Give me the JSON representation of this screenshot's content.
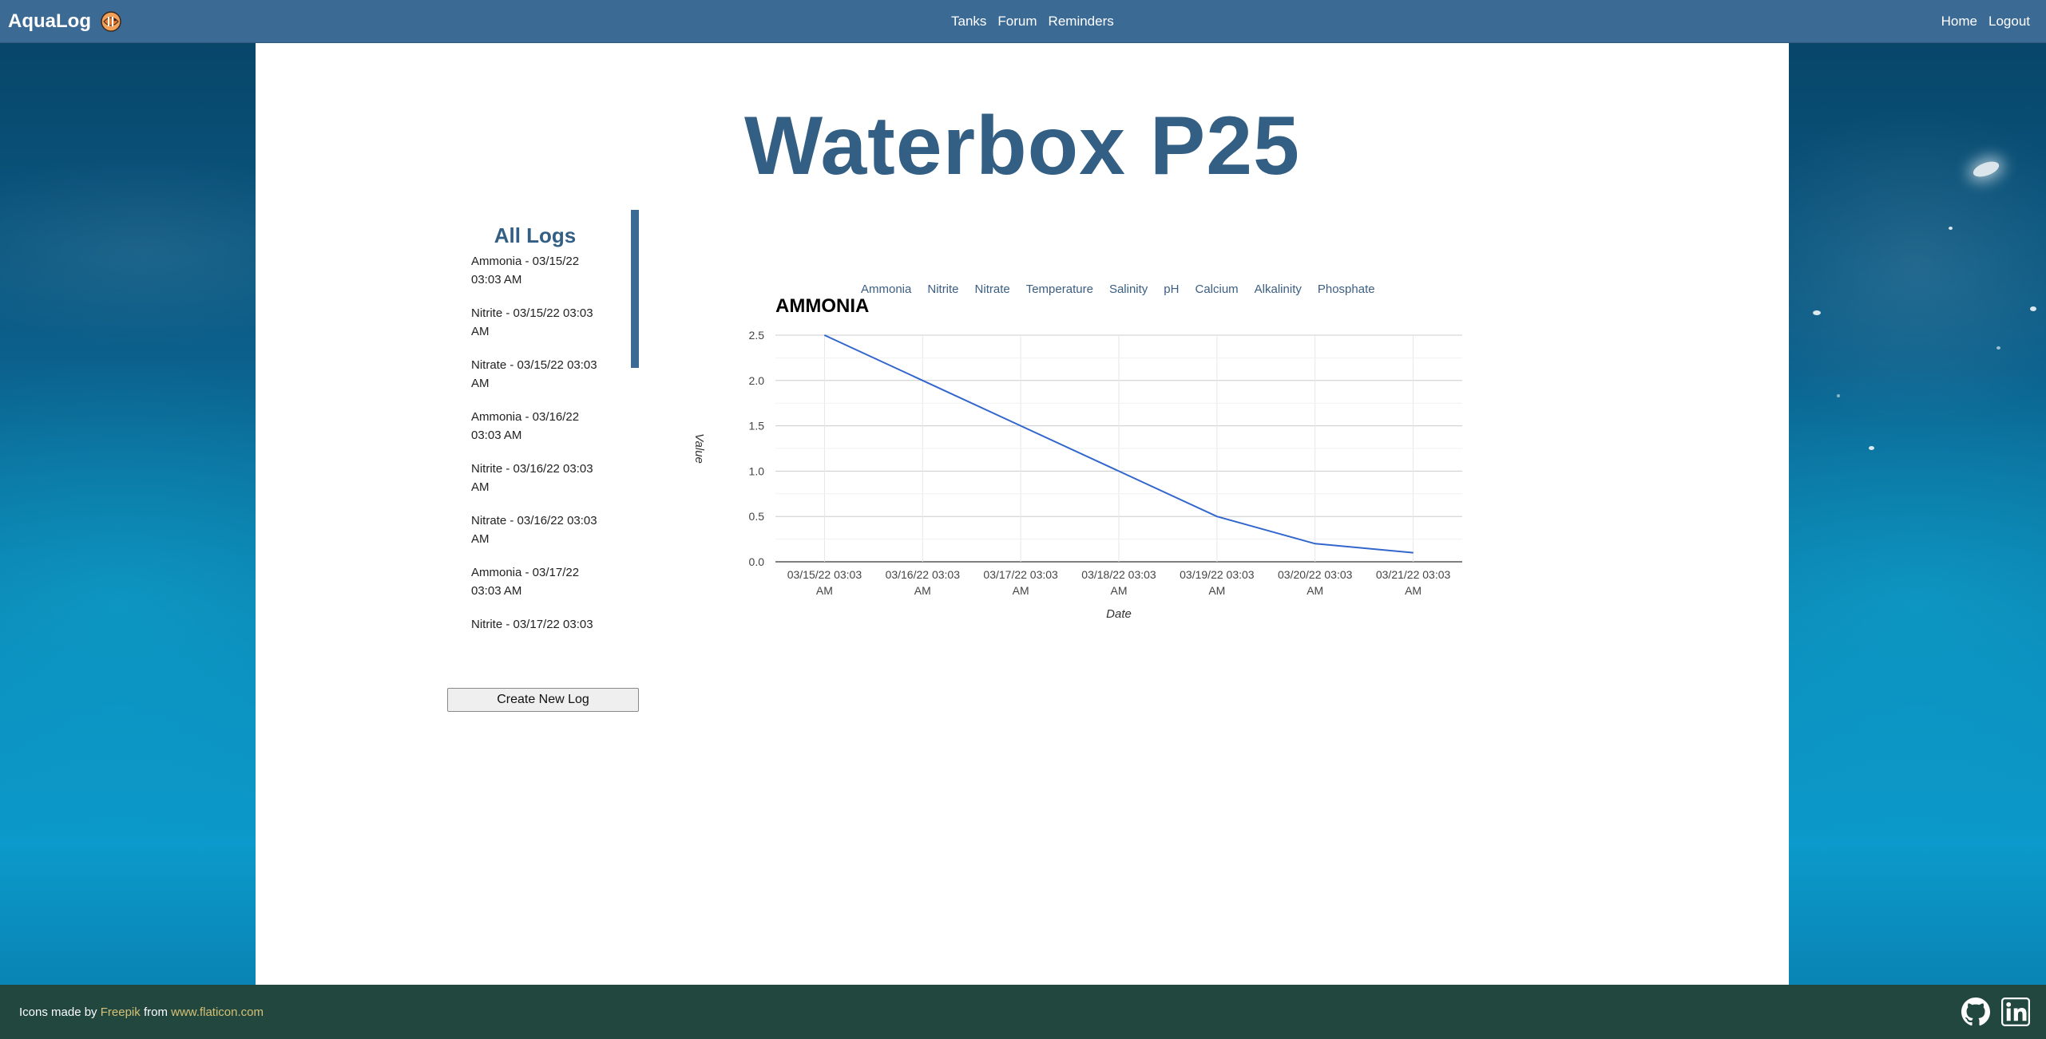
{
  "navbar": {
    "brand": "AquaLog",
    "center_links": [
      "Tanks",
      "Forum",
      "Reminders"
    ],
    "right_links": [
      "Home",
      "Logout"
    ]
  },
  "page": {
    "title": "Waterbox P25"
  },
  "logs": {
    "title": "All Logs",
    "items": [
      "Ammonia - 03/15/22 03:03 AM",
      "Nitrite - 03/15/22 03:03 AM",
      "Nitrate - 03/15/22 03:03 AM",
      "Ammonia - 03/16/22 03:03 AM",
      "Nitrite - 03/16/22 03:03 AM",
      "Nitrate - 03/16/22 03:03 AM",
      "Ammonia - 03/17/22 03:03 AM",
      "Nitrite - 03/17/22 03:03"
    ],
    "create_button": "Create New Log"
  },
  "params": [
    "Ammonia",
    "Nitrite",
    "Nitrate",
    "Temperature",
    "Salinity",
    "pH",
    "Calcium",
    "Alkalinity",
    "Phosphate"
  ],
  "chart_data": {
    "type": "line",
    "title": "AMMONIA",
    "xlabel": "Date",
    "ylabel": "Value",
    "categories": [
      "03/15/22 03:03 AM",
      "03/16/22 03:03 AM",
      "03/17/22 03:03 AM",
      "03/18/22 03:03 AM",
      "03/19/22 03:03 AM",
      "03/20/22 03:03 AM",
      "03/21/22 03:03 AM"
    ],
    "values": [
      2.5,
      2.0,
      1.5,
      1.0,
      0.5,
      0.2,
      0.1
    ],
    "ylim": [
      0,
      2.5
    ],
    "yticks": [
      "0.0",
      "0.5",
      "1.0",
      "1.5",
      "2.0",
      "2.5"
    ],
    "grid": true,
    "line_color": "#3366cc"
  },
  "footer": {
    "prefix": "Icons made by",
    "author": "Freepik",
    "middle": "from",
    "site": "www.flaticon.com"
  },
  "colors": {
    "navbar": "#3b6a95",
    "title": "#335f84",
    "footer": "#21473f",
    "footer_link": "#d6c073"
  }
}
